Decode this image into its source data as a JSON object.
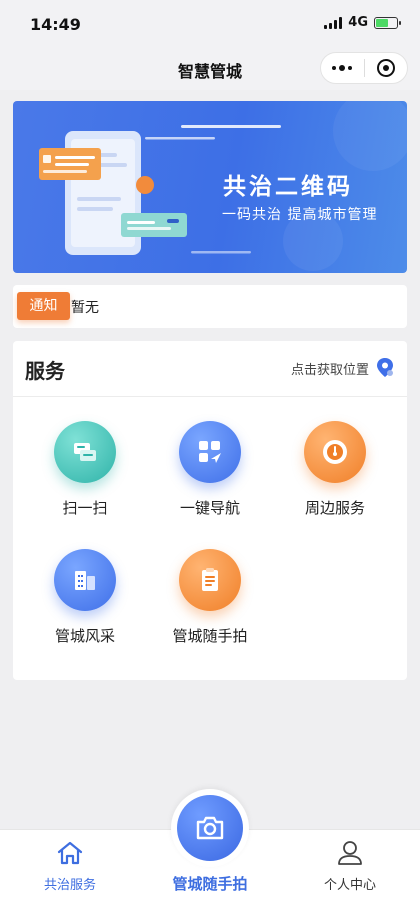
{
  "status_bar": {
    "time": "14:49",
    "network": "4G",
    "battery_level": 0.6
  },
  "nav": {
    "title": "智慧管城",
    "more_icon": "more-dots-icon",
    "close_icon": "target-circle-icon"
  },
  "banner": {
    "title": "共治二维码",
    "subtitle": "一码共治  提高城市管理"
  },
  "notice": {
    "tag": "通知",
    "text": "暂无"
  },
  "services": {
    "title": "服务",
    "location_label": "点击获取位置",
    "location_icon": "location-pin-icon",
    "items": [
      {
        "label": "扫一扫",
        "icon": "scan-icon",
        "color": "#2fb3a9"
      },
      {
        "label": "一键导航",
        "icon": "navigation-icon",
        "color": "#3f6fe8"
      },
      {
        "label": "周边服务",
        "icon": "nearby-icon",
        "color": "#f07f28"
      },
      {
        "label": "管城风采",
        "icon": "buildings-icon",
        "color": "#3f6fe8"
      },
      {
        "label": "管城随手拍",
        "icon": "clipboard-icon",
        "color": "#f07f28"
      }
    ]
  },
  "tabbar": {
    "items": [
      {
        "label": "共治服务",
        "icon": "home-icon",
        "active": true
      },
      {
        "label": "管城随手拍",
        "icon": "camera-icon",
        "active": false
      },
      {
        "label": "个人中心",
        "icon": "user-icon",
        "active": false
      }
    ],
    "accent": "#3e6ee0"
  }
}
